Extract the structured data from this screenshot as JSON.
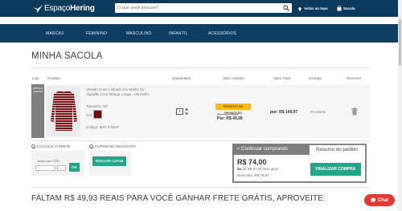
{
  "header": {
    "logo_part1": "Espaço",
    "logo_part2": "Hering",
    "search_placeholder": "O que você procura?",
    "back_to_top": "Voltar ao topo",
    "bag_label": "Sacola",
    "colors": {
      "topbar": "#0d3b5e",
      "menubar": "#0e3e61",
      "accent_green": "#23a58a",
      "promo_yellow": "#f5b91e",
      "chat_red": "#e33b2f"
    }
  },
  "menu": {
    "items": [
      "MARCAS",
      "FEMININO",
      "MASCULINO",
      "INFANTIL",
      "ACESSÓRIOS"
    ]
  },
  "page_title": "MINHA SACOLA",
  "table": {
    "headers": {
      "loja": "Loja",
      "produto": "Produto",
      "quantidade": "Quantidade",
      "valor_unitario": "Valor Unitário",
      "valor_total": "Valor Total",
      "entrega": "Entrega",
      "remover": "Remover"
    }
  },
  "product": {
    "loja_badge": "ESPAÇO HERING",
    "name": "Vestido Curto Listrado Em Malha De Algodão Com Manga Longa - Vermelho",
    "size": "Tamanho: XP",
    "color_label": "Cor:",
    "color_swatch": "#6e0d11",
    "code": "Código: 60I7 E7ENT",
    "quantity": "2",
    "promo_tag": "PRODUTO EM PROMOÇÃO",
    "old_price": "De: R$ 99,90",
    "new_price": "Por: R$ 49,99",
    "total": "por: R$ 149,97",
    "delivery": "Pendente"
  },
  "frete": {
    "label": "CALCULE O FRETE",
    "cep_label": "Insira seu CEP:",
    "ok_button": "OK"
  },
  "cupom": {
    "label": "CUPOM DE DESCONTO",
    "button": "REMOVER CUPOM"
  },
  "summary": {
    "continue_button": "< Continuar comprando",
    "title": "Resumo do pedido",
    "total": "R$ 74,00",
    "installments_prefix": "2x",
    "installments_text": "de R$ 37,00 sem juros",
    "discount": "Desconto: R$ 75,97",
    "finish_button": "FINALIZAR COMPRA"
  },
  "footer_banner": "FALTAM R$ 49,93 REAIS PARA VOCÊ GANHAR FRETE GRÁTIS, APROVEITE:",
  "chat": {
    "label": "Chat"
  }
}
